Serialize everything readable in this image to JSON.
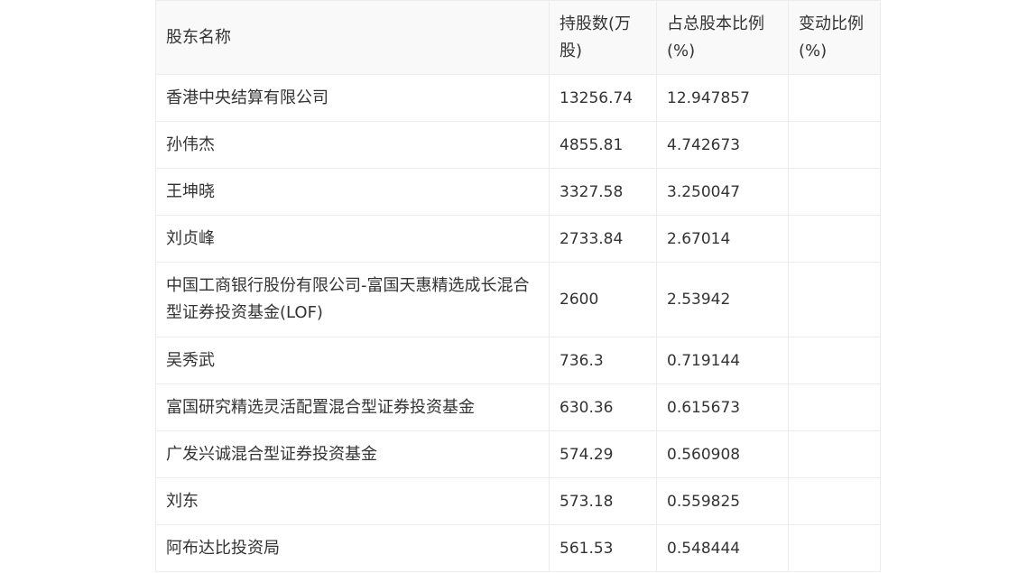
{
  "table": {
    "headers": [
      "股东名称",
      "持股数(万股)",
      "占总股本比例(%)",
      "变动比例(%)"
    ],
    "rows": [
      [
        "香港中央结算有限公司",
        "13256.74",
        "12.947857",
        ""
      ],
      [
        "孙伟杰",
        "4855.81",
        "4.742673",
        ""
      ],
      [
        "王坤晓",
        "3327.58",
        "3.250047",
        ""
      ],
      [
        "刘贞峰",
        "2733.84",
        "2.67014",
        ""
      ],
      [
        "中国工商银行股份有限公司-富国天惠精选成长混合型证券投资基金(LOF)",
        "2600",
        "2.53942",
        ""
      ],
      [
        "吴秀武",
        "736.3",
        "0.719144",
        ""
      ],
      [
        "富国研究精选灵活配置混合型证券投资基金",
        "630.36",
        "0.615673",
        ""
      ],
      [
        "广发兴诚混合型证券投资基金",
        "574.29",
        "0.560908",
        ""
      ],
      [
        "刘东",
        "573.18",
        "0.559825",
        ""
      ],
      [
        "阿布达比投资局",
        "561.53",
        "0.548444",
        ""
      ]
    ]
  }
}
